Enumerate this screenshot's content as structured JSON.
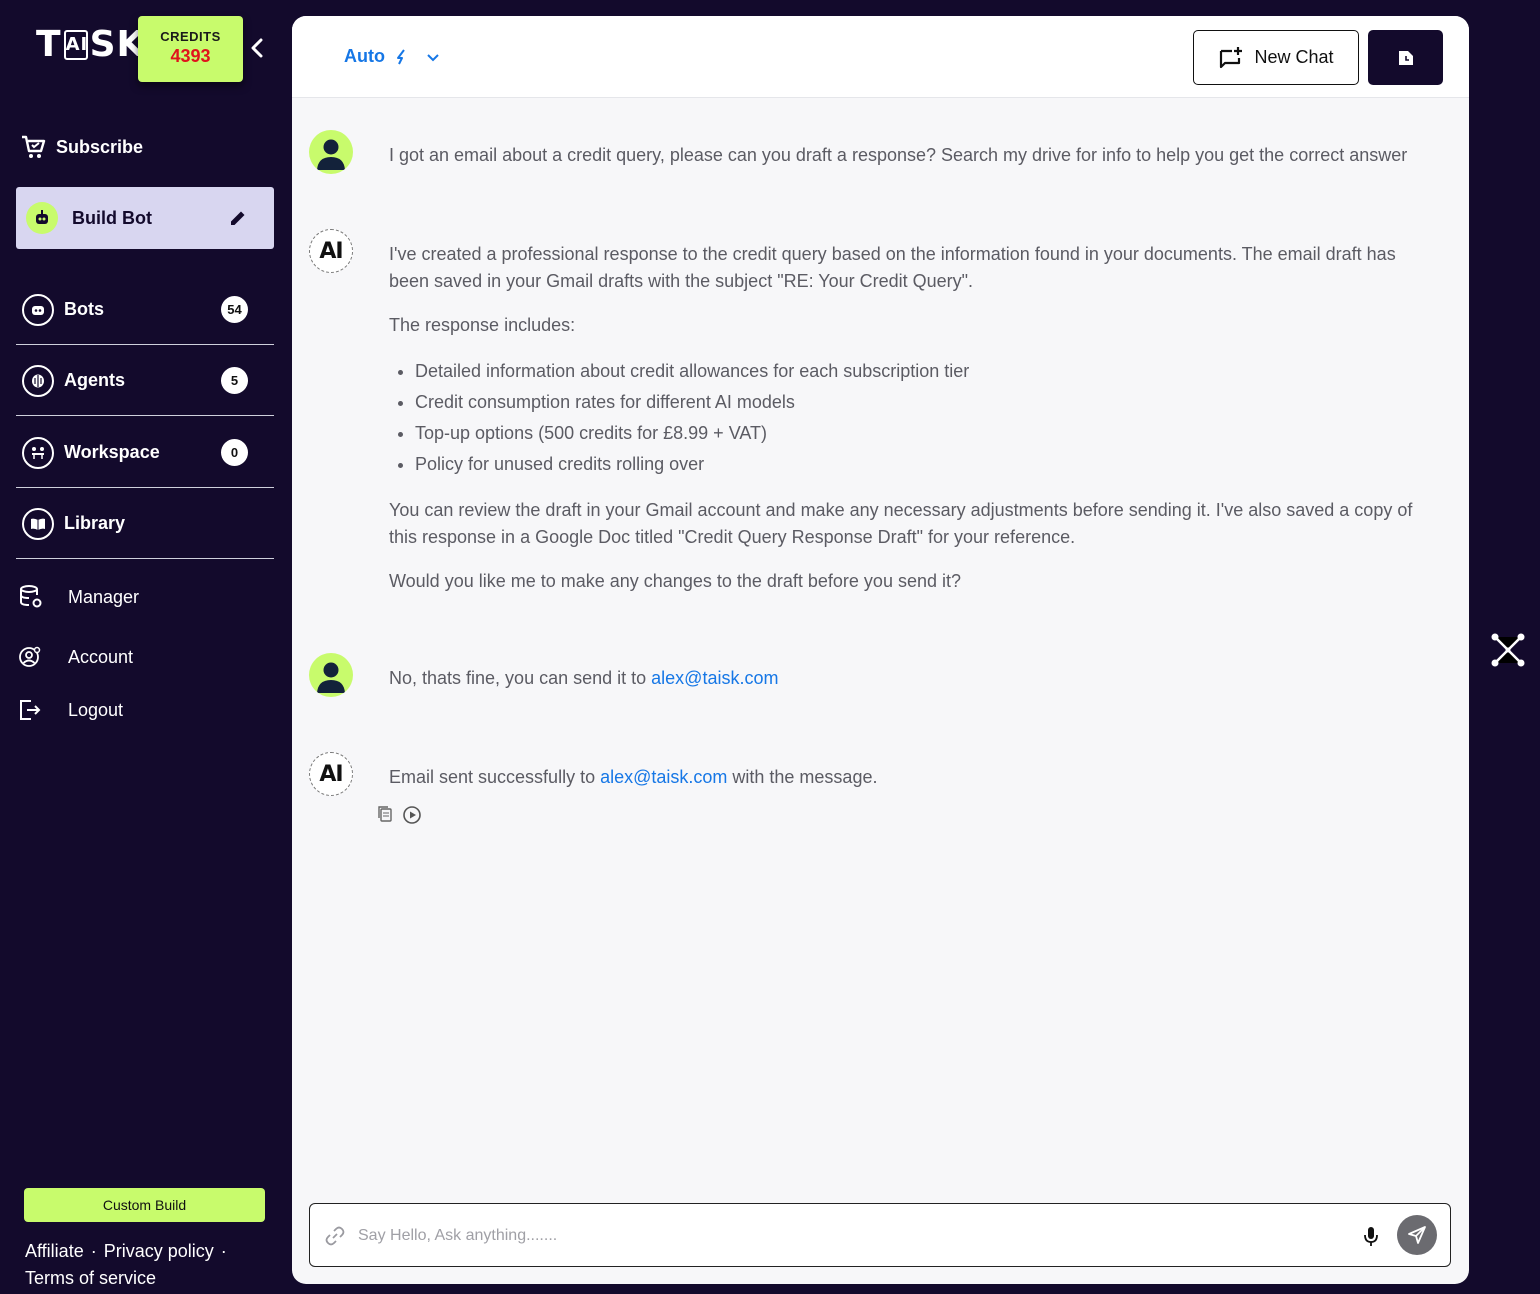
{
  "brand": {
    "logo_pre": "T",
    "logo_ai": "AI",
    "logo_post": "SK"
  },
  "credits": {
    "label": "CREDITS",
    "value": "4393",
    "value_color": "#e0141c",
    "bg_color": "#c8fb6c"
  },
  "sidebar": {
    "subscribe": "Subscribe",
    "build_bot": "Build Bot",
    "nav": [
      {
        "label": "Bots",
        "count": "54"
      },
      {
        "label": "Agents",
        "count": "5"
      },
      {
        "label": "Workspace",
        "count": "0"
      },
      {
        "label": "Library",
        "count": ""
      }
    ],
    "plain": [
      {
        "label": "Manager",
        "icon": "database-gear-icon"
      },
      {
        "label": "Account",
        "icon": "account-gear-icon"
      },
      {
        "label": "Logout",
        "icon": "logout-icon"
      }
    ],
    "custom_build": "Custom Build",
    "footer": {
      "affiliate": "Affiliate",
      "privacy": "Privacy policy",
      "terms": "Terms of service",
      "sep": "·"
    }
  },
  "topbar": {
    "model": "Auto",
    "new_chat": "New Chat"
  },
  "messages": {
    "m1": "I got an email about a credit query, please can you draft a response? Search my drive for info to help you get the correct answer",
    "m2": {
      "p1": "I've created a professional response to the credit query based on the information found in your documents. The email draft has been saved in your Gmail drafts with the subject \"RE: Your Credit Query\".",
      "p2": "The response includes:",
      "bullets": [
        "Detailed information about credit allowances for each subscription tier",
        "Credit consumption rates for different AI models",
        "Top-up options (500 credits for £8.99 + VAT)",
        "Policy for unused credits rolling over"
      ],
      "p3": "You can review the draft in your Gmail account and make any necessary adjustments before sending it. I've also saved a copy of this response in a Google Doc titled \"Credit Query Response Draft\" for your reference.",
      "p4": "Would you like me to make any changes to the draft before you send it?"
    },
    "m3": {
      "pre": "No, thats fine, you can send it to ",
      "email": "alex@taisk.com"
    },
    "m4": {
      "pre": "Email sent successfully to ",
      "email": "alex@taisk.com",
      "post": " with the message."
    },
    "ai_avatar": "AI"
  },
  "composer": {
    "placeholder": "Say Hello, Ask anything......."
  },
  "colors": {
    "bg": "#130a2c",
    "accent": "#c8fb6c",
    "link": "#1677e6"
  }
}
